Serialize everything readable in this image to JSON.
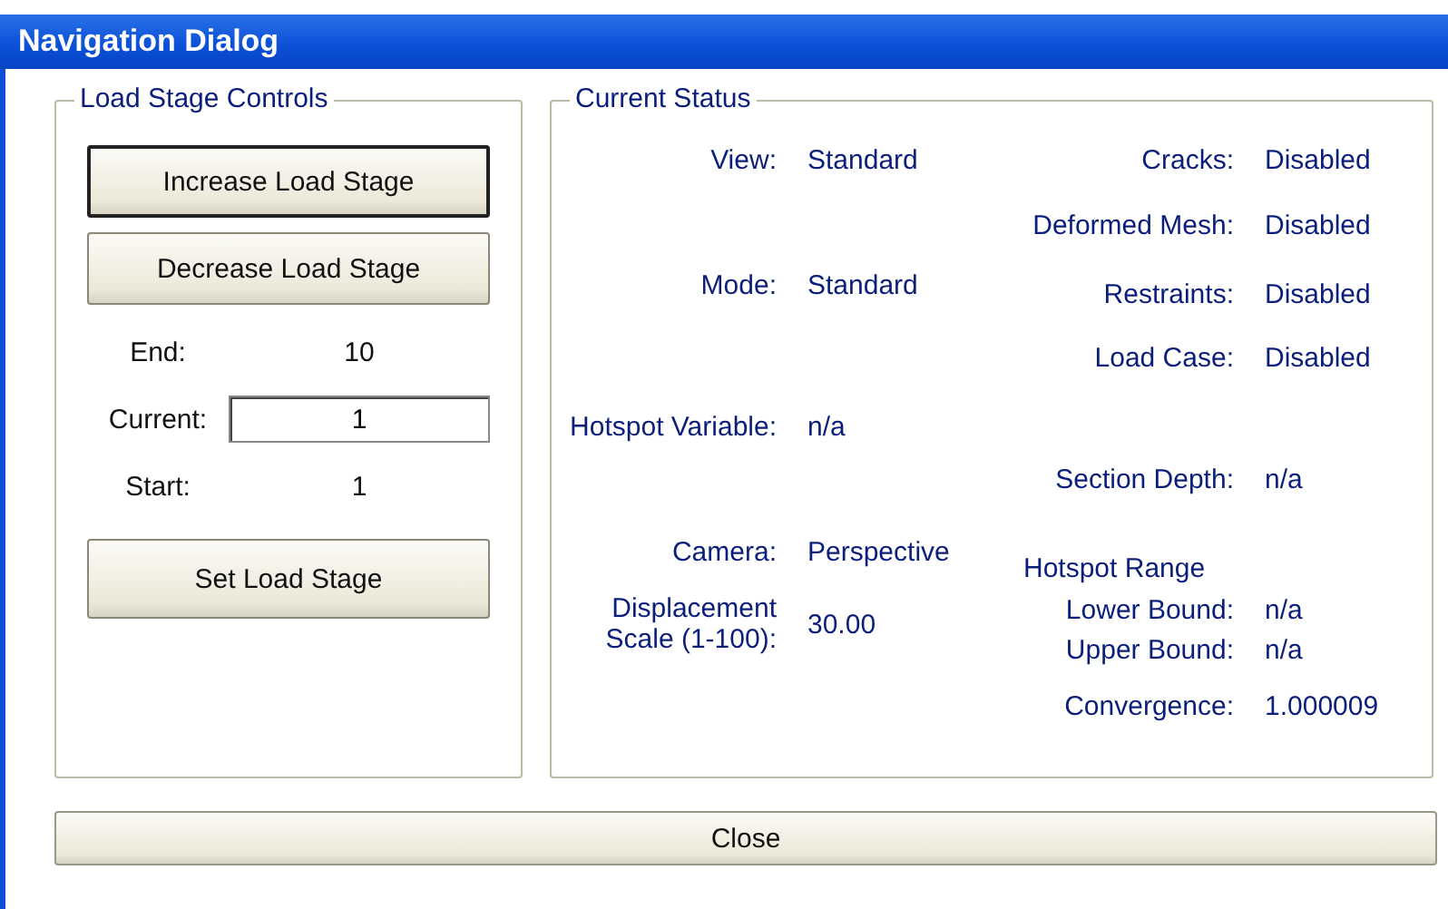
{
  "window": {
    "title": "Navigation Dialog"
  },
  "load_stage_controls": {
    "title": "Load Stage Controls",
    "buttons": [
      {
        "label": "Increase Load Stage",
        "focused": true
      },
      {
        "label": "Decrease Load Stage",
        "focused": false
      }
    ],
    "end": {
      "label": "End:",
      "value": "10"
    },
    "current": {
      "label": "Current:",
      "value": "1"
    },
    "start": {
      "label": "Start:",
      "value": "1"
    },
    "set_button": {
      "label": "Set Load Stage"
    }
  },
  "current_status": {
    "title": "Current Status",
    "left": [
      {
        "label": "View:",
        "value": "Standard"
      },
      {
        "label": "Mode:",
        "value": "Standard"
      },
      {
        "label": "Hotspot Variable:",
        "value": "n/a"
      },
      {
        "label": "Camera:",
        "value": "Perspective"
      },
      {
        "label": "Displacement Scale (1-100):",
        "value": "30.00"
      }
    ],
    "right": [
      {
        "kind": "pair",
        "label": "Cracks:",
        "value": "Disabled"
      },
      {
        "kind": "pair",
        "label": "Deformed Mesh:",
        "value": "Disabled"
      },
      {
        "kind": "pair",
        "label": "Restraints:",
        "value": "Disabled"
      },
      {
        "kind": "pair",
        "label": "Load Case:",
        "value": "Disabled"
      },
      {
        "kind": "pair",
        "label": "Section Depth:",
        "value": "n/a"
      },
      {
        "kind": "heading",
        "label": "Hotspot Range"
      },
      {
        "kind": "pair",
        "label": "Lower Bound:",
        "value": "n/a"
      },
      {
        "kind": "pair",
        "label": "Upper Bound:",
        "value": "n/a"
      },
      {
        "kind": "pair",
        "label": "Convergence:",
        "value": "1.000009"
      }
    ]
  },
  "close_button": {
    "label": "Close"
  }
}
